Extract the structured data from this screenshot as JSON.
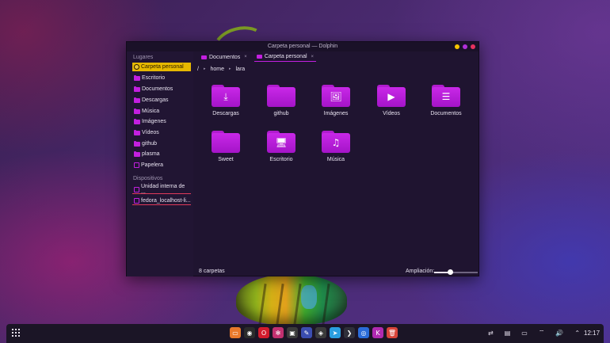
{
  "window": {
    "title": "Carpeta personal — Dolphin",
    "controls": [
      {
        "name": "minimize",
        "color": "#f5c400"
      },
      {
        "name": "maximize",
        "color": "#b02fd8"
      },
      {
        "name": "close",
        "color": "#e8335f"
      }
    ]
  },
  "sidebar": {
    "places_header": "Lugares",
    "places": [
      {
        "label": "Carpeta personal",
        "icon": "home-icon",
        "active": true
      },
      {
        "label": "Escritorio",
        "icon": "folder-icon"
      },
      {
        "label": "Documentos",
        "icon": "folder-icon"
      },
      {
        "label": "Descargas",
        "icon": "folder-icon"
      },
      {
        "label": "Música",
        "icon": "folder-icon"
      },
      {
        "label": "Imágenes",
        "icon": "folder-icon"
      },
      {
        "label": "Vídeos",
        "icon": "folder-icon"
      },
      {
        "label": "github",
        "icon": "folder-icon"
      },
      {
        "label": "plasma",
        "icon": "folder-icon"
      },
      {
        "label": "Papelera",
        "icon": "trash-icon"
      }
    ],
    "devices_header": "Dispositivos",
    "devices": [
      {
        "label": "Unidad interna de ...",
        "icon": "drive-icon"
      },
      {
        "label": "fedora_localhost-li...",
        "icon": "drive-icon"
      }
    ]
  },
  "tabs": [
    {
      "label": "Documentos",
      "close": "×"
    },
    {
      "label": "Carpeta personal",
      "close": "×"
    }
  ],
  "breadcrumb": {
    "root": "/",
    "parts": [
      "home",
      "lara"
    ],
    "separator": "▸"
  },
  "folders": [
    {
      "label": "Descargas",
      "glyph": "⤓"
    },
    {
      "label": "github",
      "glyph": ""
    },
    {
      "label": "Imágenes",
      "glyph": "🖼"
    },
    {
      "label": "Vídeos",
      "glyph": "▶"
    },
    {
      "label": "Documentos",
      "glyph": "☰"
    },
    {
      "label": "Sweet",
      "glyph": ""
    },
    {
      "label": "Escritorio",
      "glyph": "🖥"
    },
    {
      "label": "Música",
      "glyph": "♫"
    }
  ],
  "status": {
    "count": "8 carpetas",
    "zoom_label": "Ampliación:",
    "zoom_level": 0.38
  },
  "taskbar": {
    "apps": [
      {
        "name": "files-icon",
        "glyph": "▭",
        "color": "#e8792b"
      },
      {
        "name": "chrome-icon",
        "glyph": "◉",
        "color": "#2b2b2b"
      },
      {
        "name": "opera-icon",
        "glyph": "O",
        "color": "#d31b2c"
      },
      {
        "name": "settings-icon",
        "glyph": "✻",
        "color": "#c23070"
      },
      {
        "name": "store-icon",
        "glyph": "▣",
        "color": "#3a3a3a"
      },
      {
        "name": "editor-icon",
        "glyph": "✎",
        "color": "#3b4db0"
      },
      {
        "name": "image-viewer-icon",
        "glyph": "◈",
        "color": "#3a3a3a"
      },
      {
        "name": "telegram-icon",
        "glyph": "➤",
        "color": "#2a9ee0"
      },
      {
        "name": "terminal-icon",
        "glyph": "❯",
        "color": "#2f2f3a"
      },
      {
        "name": "app-icon",
        "glyph": "◎",
        "color": "#2a6bd8"
      },
      {
        "name": "kde-connect-icon",
        "glyph": "K",
        "color": "#b02ab0"
      },
      {
        "name": "trash-icon",
        "glyph": "🗑",
        "color": "#d8453a"
      }
    ],
    "tray": [
      "⇄",
      "▤",
      "▭",
      "⌔",
      "🔊",
      "⌃"
    ],
    "clock": "12:17"
  }
}
